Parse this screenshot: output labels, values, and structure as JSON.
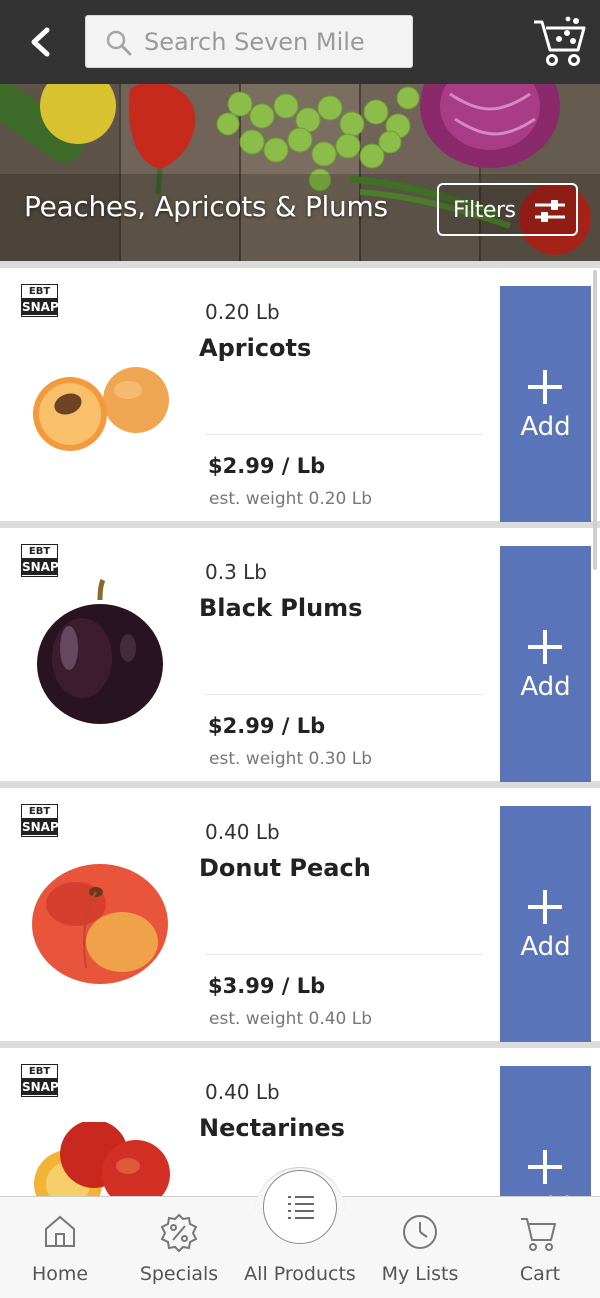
{
  "header": {
    "search_placeholder": "Search Seven Mile",
    "back_icon": "chevron-left-icon",
    "cart_icon": "cart-icon"
  },
  "banner": {
    "title": "Peaches, Apricots & Plums",
    "filters_label": "Filters"
  },
  "products": [
    {
      "badge_top": "EBT",
      "badge_bottom": "SNAP",
      "weight": "0.20 Lb",
      "name": "Apricots",
      "price": "$2.99 / Lb",
      "est_weight": "est. weight 0.20 Lb",
      "add_label": "Add"
    },
    {
      "badge_top": "EBT",
      "badge_bottom": "SNAP",
      "weight": "0.3 Lb",
      "name": "Black Plums",
      "price": "$2.99 / Lb",
      "est_weight": "est. weight 0.30 Lb",
      "add_label": "Add"
    },
    {
      "badge_top": "EBT",
      "badge_bottom": "SNAP",
      "weight": "0.40 Lb",
      "name": "Donut Peach",
      "price": "$3.99 / Lb",
      "est_weight": "est. weight 0.40 Lb",
      "add_label": "Add"
    },
    {
      "badge_top": "EBT",
      "badge_bottom": "SNAP",
      "weight": "0.40 Lb",
      "name": "Nectarines",
      "price": "",
      "est_weight": "",
      "add_label": "Add"
    }
  ],
  "bottom_nav": {
    "items": [
      {
        "label": "Home",
        "icon": "home-icon"
      },
      {
        "label": "Specials",
        "icon": "percent-badge-icon"
      },
      {
        "label": "All Products",
        "icon": "list-icon"
      },
      {
        "label": "My Lists",
        "icon": "clock-icon"
      },
      {
        "label": "Cart",
        "icon": "cart-icon"
      }
    ]
  },
  "colors": {
    "topbar": "#333333",
    "add_button": "#5974b8",
    "separator": "#dcdcdc",
    "nav_background": "#f7f7f7"
  }
}
